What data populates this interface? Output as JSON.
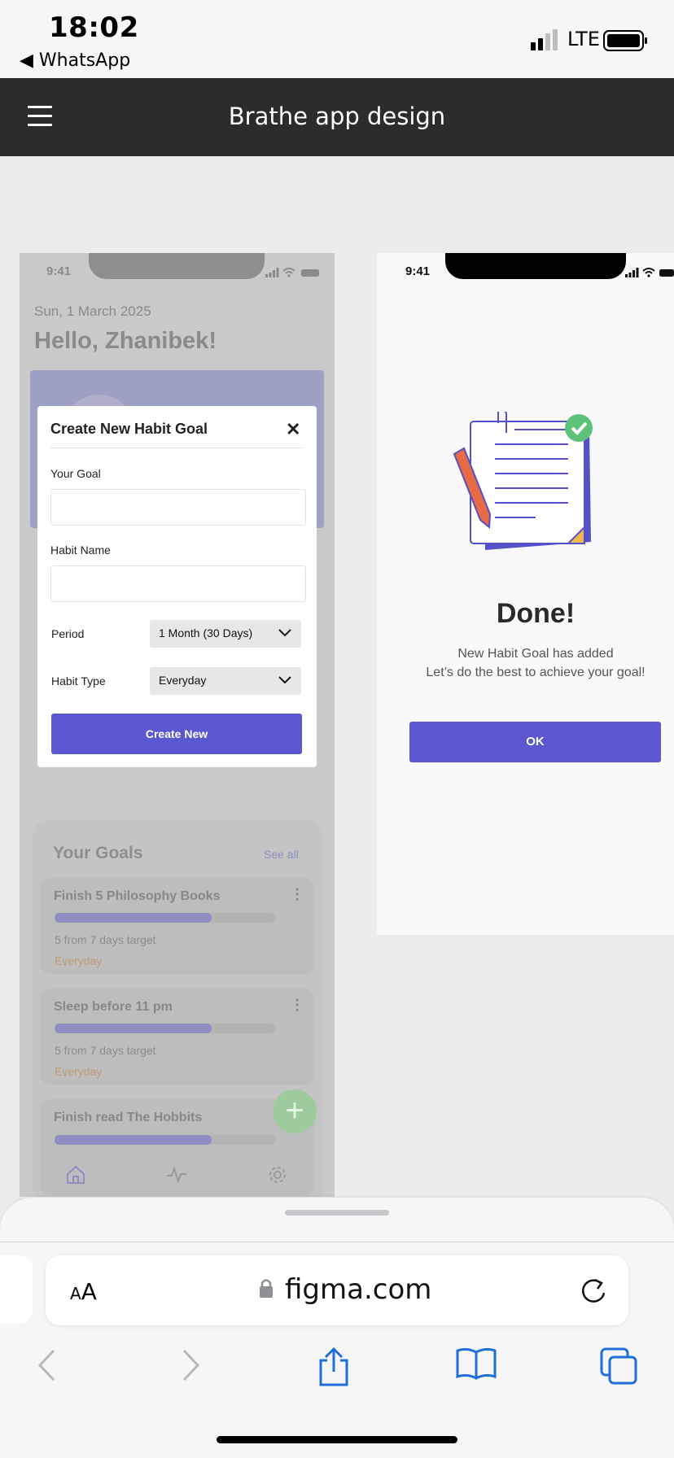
{
  "status_bar": {
    "time": "18:02",
    "back_app": "◀ WhatsApp",
    "carrier": "LTE"
  },
  "figma": {
    "file_title": "Brathe app design",
    "menu_icon": "hamburger-icon"
  },
  "frame_home": {
    "time": "9:41",
    "date": "Sun, 1 March 2025",
    "greeting": "Hello, Zhanibek!",
    "goals_title": "Your Goals",
    "see_all": "See all",
    "goals": [
      {
        "name": "Finish 5 Philosophy Books",
        "progress": 0.71,
        "target": "5 from 7 days target",
        "frequency": "Everyday"
      },
      {
        "name": "Sleep before 11 pm",
        "progress": 0.71,
        "target": "5 from 7 days target",
        "frequency": "Everyday"
      },
      {
        "name": "Finish read The Hobbits",
        "progress": 0.71
      }
    ],
    "fab_label": "+",
    "tab_icons": [
      "home-icon",
      "activity-icon",
      "settings-icon"
    ]
  },
  "modal": {
    "title": "Create New Habit Goal",
    "close": "✕",
    "goal_label": "Your Goal",
    "goal_value": "",
    "habit_name_label": "Habit Name",
    "habit_name_value": "",
    "period_label": "Period",
    "period_value": "1 Month (30 Days)",
    "habit_type_label": "Habit Type",
    "habit_type_value": "Everyday",
    "create_button": "Create New"
  },
  "frame_done": {
    "time": "9:41",
    "title": "Done!",
    "message_line1": "New Habit Goal has added",
    "message_line2": "Let’s do the best to achieve your goal!",
    "ok_button": "OK",
    "illustration": "checklist-illustration"
  },
  "safari": {
    "aa_label_big": "A",
    "aa_label_small": "A",
    "domain": "figma.com",
    "toolbar_icons": [
      "back-icon",
      "forward-icon",
      "share-icon",
      "bookmarks-icon",
      "tabs-icon"
    ]
  },
  "colors": {
    "accent": "#5b57d1",
    "header_bg": "#2c2c2c",
    "success": "#5fc27a",
    "pencil": "#e86b45"
  }
}
